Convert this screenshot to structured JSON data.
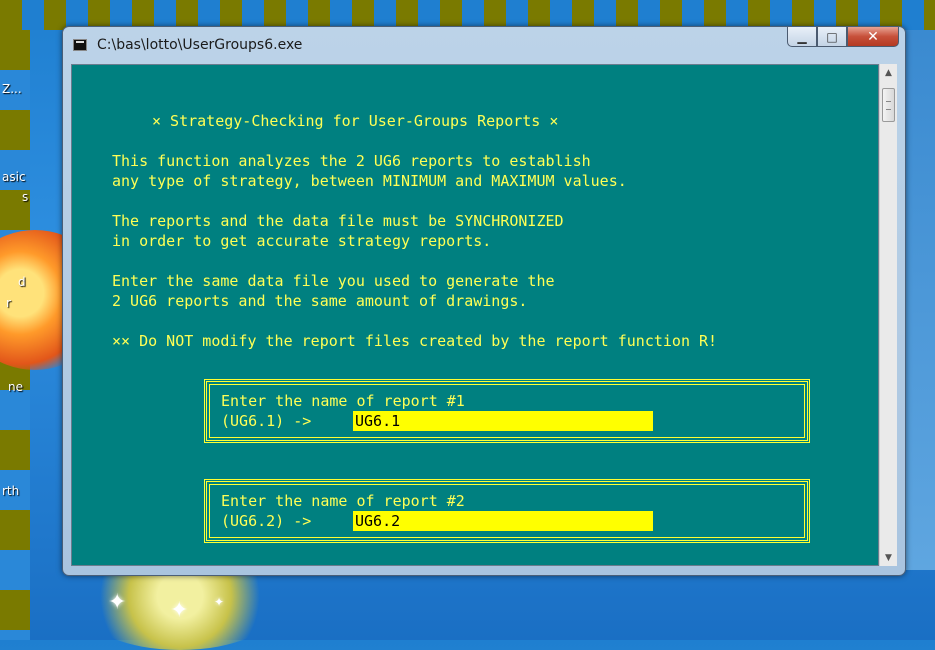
{
  "window": {
    "title": "C:\\bas\\lotto\\UserGroups6.exe",
    "minimize_glyph": "▁",
    "maximize_glyph": "□",
    "close_glyph": "✕"
  },
  "console": {
    "heading": "× Strategy-Checking for User-Groups Reports ×",
    "intro": [
      "This function analyzes the 2 UG6 reports to establish",
      "any type of strategy, between MINIMUM and MAXIMUM values.",
      "The reports and the data file must be SYNCHRONIZED",
      "in order to get accurate strategy reports.",
      "Enter the same data file you used to generate the",
      "2 UG6 reports and the same amount of drawings.",
      "×× Do NOT modify the report files created by the report function R!"
    ],
    "report1": {
      "prompt": "Enter the name of report #1",
      "label": "(UG6.1) ->",
      "value": "UG6.1"
    },
    "report2": {
      "prompt": "Enter the name of report #2",
      "label": "(UG6.2) ->",
      "value": "UG6.2"
    }
  },
  "scrollbar": {
    "up_icon": "▲",
    "down_icon": "▼"
  },
  "desktop": {
    "labels": [
      "Z...",
      "asic",
      "s",
      "d",
      "r",
      "ne",
      "rth"
    ]
  }
}
